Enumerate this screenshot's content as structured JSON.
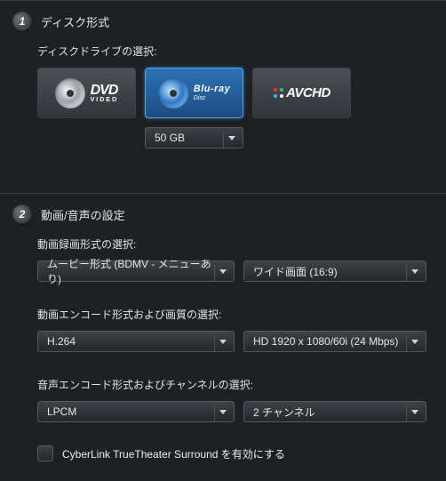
{
  "section1": {
    "number": "1",
    "title": "ディスク形式",
    "disc_drive_label": "ディスクドライブの選択:",
    "tiles": {
      "dvd": {
        "name": "DVD",
        "sub": "VIDEO"
      },
      "bluray": {
        "name": "Blu-ray",
        "sub": "Disc"
      },
      "avchd": {
        "name": "AVCHD"
      }
    },
    "capacity": "50 GB"
  },
  "section2": {
    "number": "2",
    "title": "動画/音声の設定",
    "video_format_label": "動画録画形式の選択:",
    "movie_format": "ムービー形式 (BDMV - メニューあり)",
    "aspect": "ワイド画面 (16:9)",
    "video_encode_label": "動画エンコード形式および画質の選択:",
    "video_codec": "H.264",
    "video_resolution": "HD 1920 x 1080/60i (24 Mbps)",
    "audio_encode_label": "音声エンコード形式およびチャンネルの選択:",
    "audio_codec": "LPCM",
    "audio_channels": "2 チャンネル",
    "truetheater_label": "CyberLink TrueTheater Surround を有効にする",
    "truetheater_checked": false
  }
}
